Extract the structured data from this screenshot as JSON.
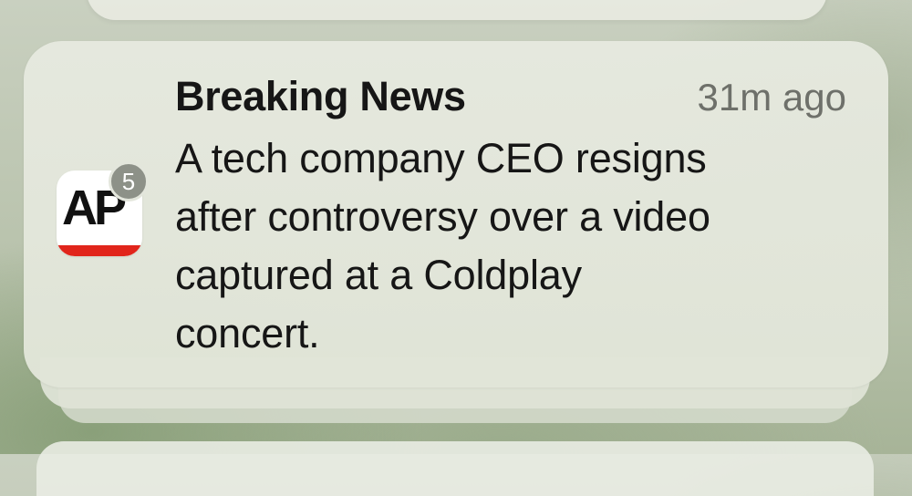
{
  "notification": {
    "app_name": "AP",
    "badge_count": "5",
    "title": "Breaking News",
    "timestamp": "31m ago",
    "body_lines": [
      "A tech company CEO resigns",
      "after controversy over a video",
      "captured at a Coldplay",
      "concert."
    ]
  },
  "colors": {
    "accent_red": "#e1251b",
    "card_background": "#e4e7dc",
    "badge_background": "#8d9188"
  },
  "icons": {
    "app_icon": "ap-logo-icon"
  }
}
